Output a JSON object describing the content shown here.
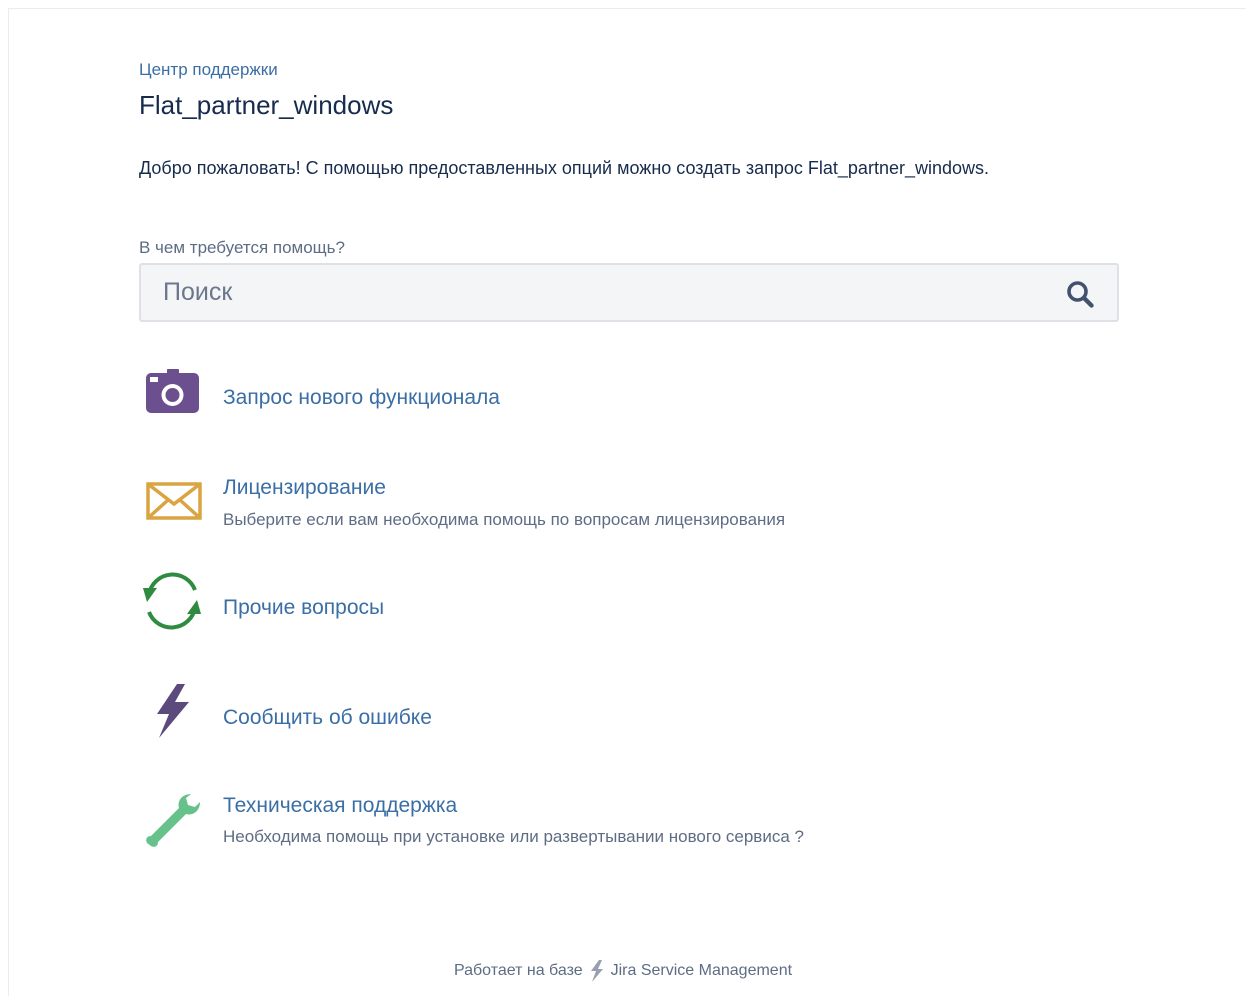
{
  "breadcrumb": "Центр поддержки",
  "page_title": "Flat_partner_windows",
  "welcome": "Добро пожаловать! С помощью предоставленных опций можно создать запрос Flat_partner_windows.",
  "search": {
    "label": "В чем требуется помощь?",
    "placeholder": "Поиск",
    "value": ""
  },
  "request_types": [
    {
      "icon": "camera-icon",
      "color": "#6b4f8f",
      "title": "Запрос нового функционала",
      "description": ""
    },
    {
      "icon": "envelope-icon",
      "color": "#d9a441",
      "title": "Лицензирование",
      "description": "Выберите если вам необходима помощь по вопросам лицензирования"
    },
    {
      "icon": "refresh-icon",
      "color": "#2e8b3f",
      "title": "Прочие вопросы",
      "description": ""
    },
    {
      "icon": "lightning-icon",
      "color": "#5c4a7d",
      "title": "Сообщить об ошибке",
      "description": ""
    },
    {
      "icon": "wrench-icon",
      "color": "#67c18a",
      "title": "Техническая поддержка",
      "description": "Необходима помощь при установке или развертывании нового сервиса ?"
    }
  ],
  "footer": {
    "prefix": "Работает на базе",
    "product": "Jira Service Management"
  }
}
